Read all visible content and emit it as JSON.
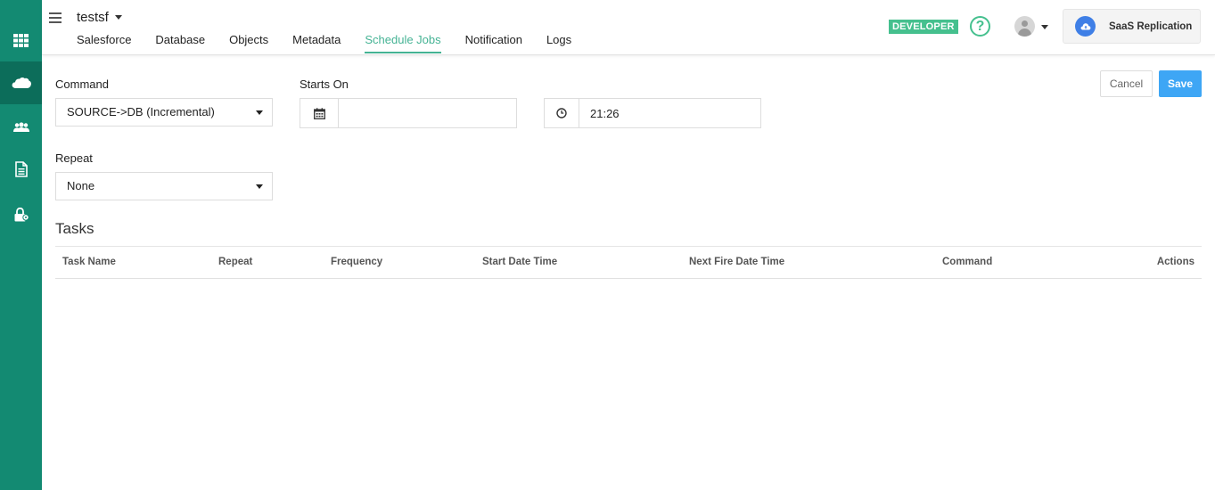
{
  "header": {
    "project_name": "testsf",
    "tabs": [
      {
        "label": "Salesforce"
      },
      {
        "label": "Database"
      },
      {
        "label": "Objects"
      },
      {
        "label": "Metadata"
      },
      {
        "label": "Schedule Jobs",
        "active": true
      },
      {
        "label": "Notification"
      },
      {
        "label": "Logs"
      }
    ],
    "badge": "DEVELOPER",
    "help_symbol": "?",
    "app_name": "SaaS Replication"
  },
  "sidebar": {
    "items": [
      {
        "icon": "grid-icon"
      },
      {
        "icon": "salesforce-cloud-icon",
        "active": true
      },
      {
        "icon": "users-icon"
      },
      {
        "icon": "document-icon"
      },
      {
        "icon": "lock-icon"
      }
    ]
  },
  "form": {
    "command_label": "Command",
    "command_value": "SOURCE->DB (Incremental)",
    "starts_on_label": "Starts On",
    "date_value": "",
    "time_value": "21:26",
    "repeat_label": "Repeat",
    "repeat_value": "None",
    "cancel_label": "Cancel",
    "save_label": "Save"
  },
  "tasks": {
    "title": "Tasks",
    "columns": [
      "Task Name",
      "Repeat",
      "Frequency",
      "Start Date Time",
      "Next Fire Date Time",
      "Command",
      "Actions"
    ],
    "rows": []
  },
  "colors": {
    "sidebar": "#138a72",
    "accent": "#45b394",
    "badge": "#45c08e",
    "primary_button": "#3ea6f5"
  }
}
